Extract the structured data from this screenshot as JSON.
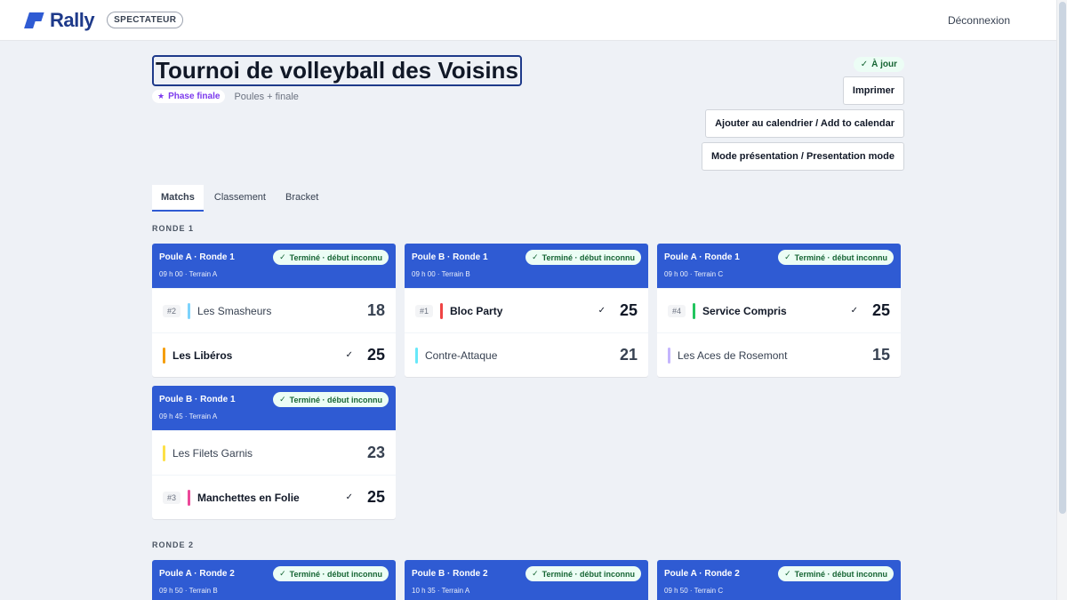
{
  "app": {
    "brand": "Rally",
    "role": "SPECTATEUR",
    "logout": "Déconnexion"
  },
  "tournament": {
    "title": "Tournoi de volleyball des Voisins",
    "phase_chip": "Phase finale",
    "format": "Poules + finale",
    "status": "À jour"
  },
  "actions": {
    "print": "Imprimer",
    "calendar": "Ajouter au calendrier / Add to calendar",
    "presentation": "Mode présentation / Presentation mode"
  },
  "tabs": [
    {
      "label": "Matchs",
      "active": true
    },
    {
      "label": "Classement",
      "active": false
    },
    {
      "label": "Bracket",
      "active": false
    }
  ],
  "sections": [
    {
      "label": "RONDE 1",
      "matches": [
        {
          "header": "Poule A · Ronde 1",
          "status": "Terminé · début inconnu",
          "info": "09 h 00 · Terrain A",
          "teams": [
            {
              "seed": "#2",
              "name": "Les Smasheurs",
              "score": "18",
              "winner": false,
              "color": "#7dd3fc"
            },
            {
              "seed": "",
              "name": "Les Libéros",
              "score": "25",
              "winner": true,
              "color": "#f59e0b"
            }
          ]
        },
        {
          "header": "Poule B · Ronde 1",
          "status": "Terminé · début inconnu",
          "info": "09 h 00 · Terrain B",
          "teams": [
            {
              "seed": "#1",
              "name": "Bloc Party",
              "score": "25",
              "winner": true,
              "color": "#ef4444"
            },
            {
              "seed": "",
              "name": "Contre-Attaque",
              "score": "21",
              "winner": false,
              "color": "#67e8f9"
            }
          ]
        },
        {
          "header": "Poule A · Ronde 1",
          "status": "Terminé · début inconnu",
          "info": "09 h 00 · Terrain C",
          "teams": [
            {
              "seed": "#4",
              "name": "Service Compris",
              "score": "25",
              "winner": true,
              "color": "#22c55e"
            },
            {
              "seed": "",
              "name": "Les Aces de Rosemont",
              "score": "15",
              "winner": false,
              "color": "#c4b5fd"
            }
          ]
        },
        {
          "header": "Poule B · Ronde 1",
          "status": "Terminé · début inconnu",
          "info": "09 h 45 · Terrain A",
          "teams": [
            {
              "seed": "",
              "name": "Les Filets Garnis",
              "score": "23",
              "winner": false,
              "color": "#fde047"
            },
            {
              "seed": "#3",
              "name": "Manchettes en Folie",
              "score": "25",
              "winner": true,
              "color": "#ec4899"
            }
          ]
        }
      ]
    },
    {
      "label": "RONDE 2",
      "matches": [
        {
          "header": "Poule A · Ronde 2",
          "status": "Terminé · début inconnu",
          "info": "09 h 50 · Terrain B",
          "teams": []
        },
        {
          "header": "Poule B · Ronde 2",
          "status": "Terminé · début inconnu",
          "info": "10 h 35 · Terrain A",
          "teams": []
        },
        {
          "header": "Poule A · Ronde 2",
          "status": "Terminé · début inconnu",
          "info": "09 h 50 · Terrain C",
          "teams": []
        }
      ]
    }
  ]
}
